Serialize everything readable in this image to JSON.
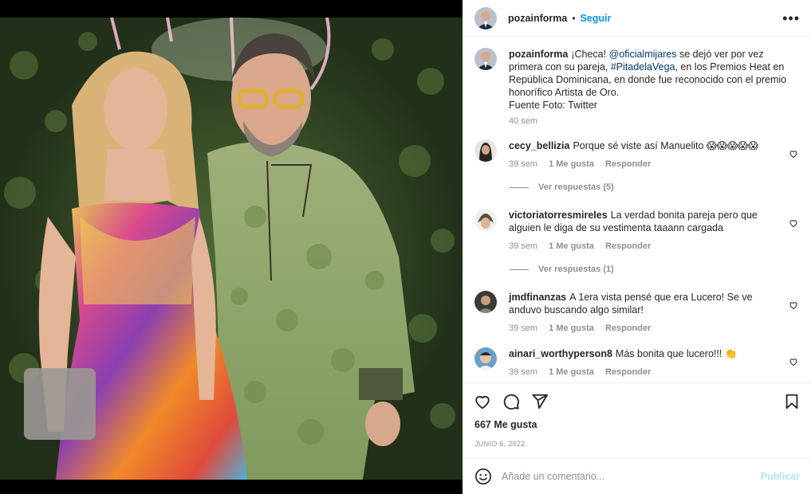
{
  "post": {
    "username": "pozainforma",
    "follow_label": "Seguir",
    "separator": "•",
    "more_label": "•••",
    "photo_alt": "photo",
    "caption": {
      "prefix": "¡Checa! ",
      "mention": "@oficialmijares",
      "mid1": " se dejó ver por vez primera con su pareja, ",
      "hashtag": "#PitadelaVega",
      "mid2": ", en los Premios Heat en República Dominicana, en donde fue reconocido con el premio honorífico Artista de Oro.",
      "source": "Fuente Foto: Twitter",
      "time": "40 sem"
    },
    "comments": [
      {
        "user": "cecy_bellizia",
        "text": "Porque sé viste así Manuelito 😱😱😱😱😱",
        "time": "39 sem",
        "likes": "1 Me gusta",
        "reply": "Responder",
        "view_replies": "Ver respuestas (5)"
      },
      {
        "user": "victoriatorresmireles",
        "text": "La verdad bonita pareja pero que alguien le diga de su vestimenta taaann cargada",
        "time": "39 sem",
        "likes": "1 Me gusta",
        "reply": "Responder",
        "view_replies": "Ver respuestas (1)"
      },
      {
        "user": "jmdfinanzas",
        "text": "A 1era vista pensé que era Lucero! Se ve anduvo buscando algo similar!",
        "time": "39 sem",
        "likes": "1 Me gusta",
        "reply": "Responder"
      },
      {
        "user": "ainari_worthyperson8",
        "text": "Más bonita que lucero!!! 👏",
        "time": "39 sem",
        "likes": "1 Me gusta",
        "reply": "Responder"
      }
    ],
    "likes_count": "667 Me gusta",
    "date": "JUNIO 6, 2022",
    "comment_placeholder": "Añade un comentario...",
    "publish_label": "Publicar"
  },
  "colors": {
    "accent": "#0095f6",
    "link": "#00376b",
    "muted": "#8e8e8e",
    "publish_disabled": "#b2dffc"
  }
}
